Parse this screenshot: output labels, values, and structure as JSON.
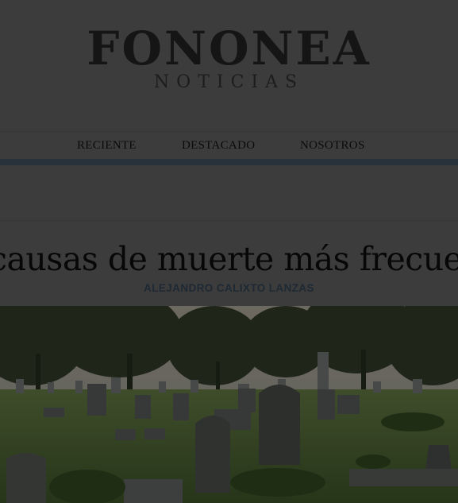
{
  "header": {
    "brand": "FONONEA",
    "subbrand": "NOTICIAS"
  },
  "nav": {
    "items": [
      {
        "label": "RECIENTE"
      },
      {
        "label": "DESTACADO"
      },
      {
        "label": "NOSOTROS"
      }
    ]
  },
  "article": {
    "title": "causas de muerte más frecuen",
    "author": "ALEJANDRO CALIXTO LANZAS",
    "image_subject": "cemetery-photo"
  },
  "colors": {
    "accent_bar": "#4e6477",
    "author": "#3d5266",
    "overlay": "rgba(0,0,0,0.5)"
  }
}
